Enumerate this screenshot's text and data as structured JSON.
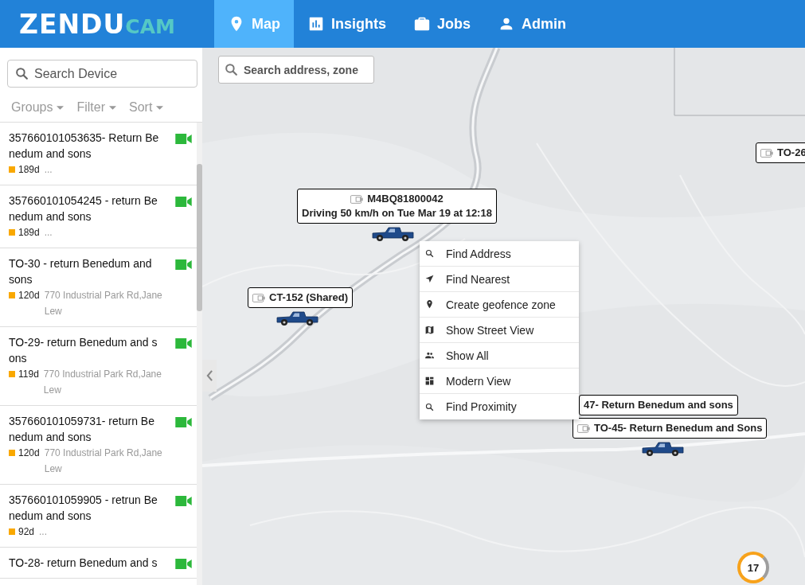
{
  "header": {
    "logo_main": "ZENDU",
    "logo_accent": "CAM",
    "tabs": [
      {
        "label": "Map",
        "selected": true
      },
      {
        "label": "Insights",
        "selected": false
      },
      {
        "label": "Jobs",
        "selected": false
      },
      {
        "label": "Admin",
        "selected": false
      }
    ]
  },
  "sidebar": {
    "search": {
      "placeholder": "Search Device"
    },
    "filters": [
      "Groups",
      "Filter",
      "Sort"
    ],
    "devices": [
      {
        "title": "357660101053635- Return Benedum and sons",
        "age": "189d",
        "address": "..."
      },
      {
        "title": "357660101054245 - return Benedum and sons",
        "age": "189d",
        "address": "..."
      },
      {
        "title": "TO-30 - return Benedum and sons",
        "age": "120d",
        "address": "770 Industrial Park Rd,Jane Lew"
      },
      {
        "title": "TO-29- return Benedum and sons",
        "age": "119d",
        "address": "770 Industrial Park Rd,Jane Lew"
      },
      {
        "title": "357660101059731- return Benedum and sons",
        "age": "120d",
        "address": "770 Industrial Park Rd,Jane Lew"
      },
      {
        "title": "357660101059905 - retrun Benedum and sons",
        "age": "92d",
        "address": "..."
      },
      {
        "title": "TO-28- return Benedum and s"
      }
    ]
  },
  "map": {
    "search": {
      "placeholder": "Search address, zone"
    },
    "vehicles": [
      {
        "name": "M4BQ81800042",
        "status": "Driving 50 km/h on Tue Mar 19 at 12:18",
        "device_icon": true
      },
      {
        "name": "CT-152 (Shared)",
        "device_icon": true
      },
      {
        "name": "47- Return Benedum and sons",
        "device_icon": false
      },
      {
        "name": "TO-45- Return Benedum and Sons",
        "device_icon": true
      },
      {
        "name": "TO-26",
        "device_icon": true
      }
    ],
    "context_menu": [
      "Find Address",
      "Find Nearest",
      "Create geofence zone",
      "Show Street View",
      "Show All",
      "Modern View",
      "Find Proximity"
    ],
    "cluster": {
      "count": "17"
    }
  }
}
